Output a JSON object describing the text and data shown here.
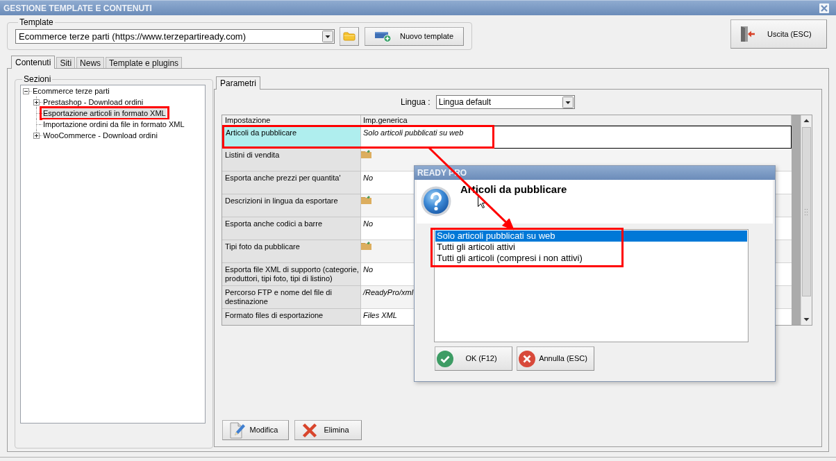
{
  "window": {
    "title": "GESTIONE TEMPLATE E CONTENUTI"
  },
  "template": {
    "group_label": "Template",
    "value": "Ecommerce terze parti (https://www.terzepartiready.com)",
    "new_button": "Nuovo template"
  },
  "exit_button": {
    "label": "Uscita (ESC)"
  },
  "tabs": [
    {
      "label": "Contenuti",
      "selected": true
    },
    {
      "label": "Siti",
      "selected": false
    },
    {
      "label": "News",
      "selected": false
    },
    {
      "label": "Template e plugins",
      "selected": false
    }
  ],
  "sections": {
    "group_label": "Sezioni",
    "tree": [
      {
        "label": "Ecommerce terze parti",
        "kind": "group",
        "expanded": true,
        "selected": false,
        "highlighted": false,
        "children": [
          {
            "label": "Prestashop - Download ordini",
            "kind": "group",
            "expanded": false,
            "selected": false,
            "highlighted": false
          },
          {
            "label": "Esportazione articoli in formato XML",
            "kind": "leaf",
            "selected": true,
            "highlighted": true
          },
          {
            "label": "Importazione ordini da file in formato XML",
            "kind": "leaf",
            "selected": false,
            "highlighted": false
          },
          {
            "label": "WooCommerce - Download ordini",
            "kind": "group",
            "expanded": false,
            "selected": false,
            "highlighted": false
          }
        ]
      }
    ]
  },
  "parameters": {
    "tabs": [
      {
        "label": "Parametri",
        "selected": true
      }
    ],
    "language": {
      "label": "Lingua :",
      "value": "Lingua default"
    },
    "table": {
      "columns": [
        "Impostazione",
        "Imp.generica"
      ],
      "rows": [
        {
          "setting": "Articoli da pubblicare",
          "kind": "text",
          "value": "Solo articoli pubblicati su web",
          "selected": true,
          "highlighted": true
        },
        {
          "setting": "Listini di vendita",
          "kind": "folder",
          "selected": false,
          "highlighted": false
        },
        {
          "setting": "Esporta anche prezzi per quantita'",
          "kind": "text",
          "value": "No",
          "selected": false,
          "highlighted": false
        },
        {
          "setting": "Descrizioni in lingua da esportare",
          "kind": "folder",
          "selected": false,
          "highlighted": false
        },
        {
          "setting": "Esporta anche codici a barre",
          "kind": "text",
          "value": "No",
          "selected": false,
          "highlighted": false
        },
        {
          "setting": "Tipi foto da pubblicare",
          "kind": "folder",
          "selected": false,
          "highlighted": false
        },
        {
          "setting": "Esporta file XML di supporto (categorie, produttori, tipi foto, tipi di listino)",
          "kind": "text",
          "value": "No",
          "selected": false,
          "highlighted": false
        },
        {
          "setting": "Percorso FTP e nome del file di destinazione",
          "kind": "text",
          "value": "/ReadyPro/xml",
          "selected": false,
          "highlighted": false
        },
        {
          "setting": "Formato files di esportazione",
          "kind": "text",
          "value": "Files XML",
          "selected": false,
          "highlighted": false
        }
      ]
    },
    "buttons": [
      {
        "label": "Modifica",
        "kind": "edit"
      },
      {
        "label": "Elimina",
        "kind": "delete"
      }
    ]
  },
  "dialog": {
    "title": "READY PRO",
    "heading": "Articoli da pubblicare",
    "options": [
      {
        "label": "Solo articoli pubblicati su web",
        "selected": true
      },
      {
        "label": "Tutti gli articoli attivi",
        "selected": false
      },
      {
        "label": "Tutti gli articoli (compresi i non attivi)",
        "selected": false
      }
    ],
    "options_highlighted": true,
    "callout_arrow": true,
    "buttons": [
      {
        "label": "OK (F12)",
        "kind": "confirm"
      },
      {
        "label": "Annulla (ESC)",
        "kind": "cancel"
      }
    ]
  }
}
